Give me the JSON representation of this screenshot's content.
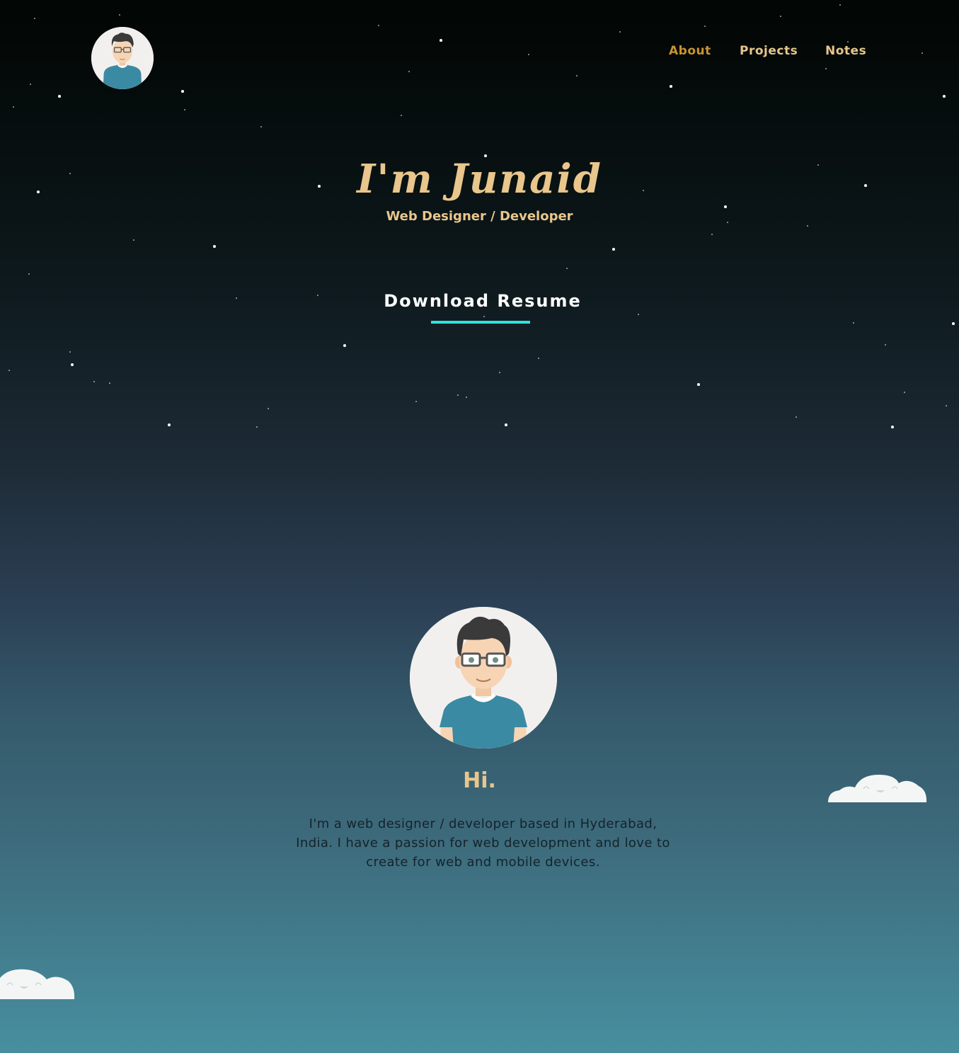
{
  "nav": {
    "items": [
      {
        "label": "About"
      },
      {
        "label": "Projects"
      },
      {
        "label": "Notes"
      }
    ]
  },
  "hero": {
    "name": "I'm Junaid",
    "subtitle": "Web Designer / Developer",
    "cta_label": "Download Resume"
  },
  "intro": {
    "greeting": "Hi.",
    "bio": "I'm a web designer / developer based in Hyderabad, India. I have a passion for web development and love to create for web and mobile devices."
  },
  "icons": {
    "logo": "avatar-logo-icon",
    "avatar": "avatar-portrait-icon",
    "clouds": "cloud-icon"
  },
  "colors": {
    "accent_gold": "#e9c68c",
    "nav_active": "#c89430",
    "nav_link": "#e6c58c",
    "underline": "#2fe3dd",
    "shirt": "#3b8aa3"
  }
}
